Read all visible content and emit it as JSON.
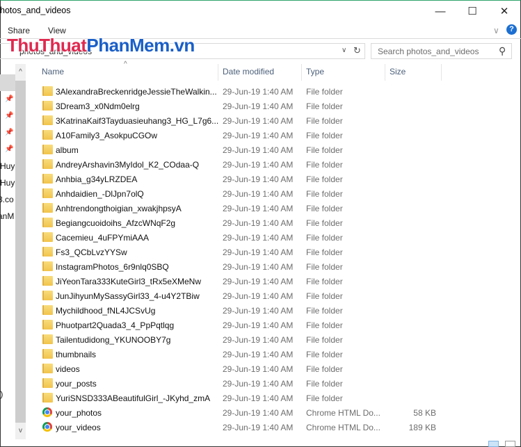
{
  "window": {
    "title": "hotos_and_videos",
    "minimize": "—",
    "maximize": "☐",
    "close": "✕"
  },
  "ribbon": {
    "share": "Share",
    "view": "View",
    "expand": "∨",
    "help": "?"
  },
  "watermark": {
    "part1": "ThuThuat",
    "part2": "PhanMem.vn"
  },
  "address": {
    "path": "photos_and_videos",
    "dropdown": "∨",
    "refresh": "↻"
  },
  "search": {
    "placeholder": "Search photos_and_videos",
    "icon": "⚲"
  },
  "nav": {
    "fragments": [
      "Huy",
      "Huy",
      "3.co",
      "anM",
      ":)"
    ]
  },
  "columns": {
    "name": "Name",
    "date": "Date modified",
    "type": "Type",
    "size": "Size"
  },
  "files": [
    {
      "name": "3AlexandraBreckenridgeJessieTheWalkin...",
      "date": "29-Jun-19 1:40 AM",
      "type": "File folder",
      "size": "",
      "icon": "folder"
    },
    {
      "name": "3Dream3_x0Ndm0elrg",
      "date": "29-Jun-19 1:40 AM",
      "type": "File folder",
      "size": "",
      "icon": "folder"
    },
    {
      "name": "3KatrinaKaif3Tayduasieuhang3_HG_L7g6...",
      "date": "29-Jun-19 1:40 AM",
      "type": "File folder",
      "size": "",
      "icon": "folder"
    },
    {
      "name": "A10Family3_AsokpuCGOw",
      "date": "29-Jun-19 1:40 AM",
      "type": "File folder",
      "size": "",
      "icon": "folder"
    },
    {
      "name": "album",
      "date": "29-Jun-19 1:40 AM",
      "type": "File folder",
      "size": "",
      "icon": "folder"
    },
    {
      "name": "AndreyArshavin3MyIdol_K2_COdaa-Q",
      "date": "29-Jun-19 1:40 AM",
      "type": "File folder",
      "size": "",
      "icon": "folder"
    },
    {
      "name": "Anhbia_g34yLRZDEA",
      "date": "29-Jun-19 1:40 AM",
      "type": "File folder",
      "size": "",
      "icon": "folder"
    },
    {
      "name": "Anhdaidien_-DlJpn7olQ",
      "date": "29-Jun-19 1:40 AM",
      "type": "File folder",
      "size": "",
      "icon": "folder"
    },
    {
      "name": "Anhtrendongthoigian_xwakjhpsyA",
      "date": "29-Jun-19 1:40 AM",
      "type": "File folder",
      "size": "",
      "icon": "folder"
    },
    {
      "name": "Begiangcuoidoihs_AfzcWNqF2g",
      "date": "29-Jun-19 1:40 AM",
      "type": "File folder",
      "size": "",
      "icon": "folder"
    },
    {
      "name": "Cacemieu_4uFPYmiAAA",
      "date": "29-Jun-19 1:40 AM",
      "type": "File folder",
      "size": "",
      "icon": "folder"
    },
    {
      "name": "Fs3_QCbLvzYYSw",
      "date": "29-Jun-19 1:40 AM",
      "type": "File folder",
      "size": "",
      "icon": "folder"
    },
    {
      "name": "InstagramPhotos_6r9nlq0SBQ",
      "date": "29-Jun-19 1:40 AM",
      "type": "File folder",
      "size": "",
      "icon": "folder"
    },
    {
      "name": "JiYeonTara333KuteGirl3_tRx5eXMeNw",
      "date": "29-Jun-19 1:40 AM",
      "type": "File folder",
      "size": "",
      "icon": "folder"
    },
    {
      "name": "JunJihyunMySassyGirl33_4-u4Y2TBiw",
      "date": "29-Jun-19 1:40 AM",
      "type": "File folder",
      "size": "",
      "icon": "folder"
    },
    {
      "name": "Mychildhood_fNL4JCSvUg",
      "date": "29-Jun-19 1:40 AM",
      "type": "File folder",
      "size": "",
      "icon": "folder"
    },
    {
      "name": "Phuotpart2Quada3_4_PpPqtlqg",
      "date": "29-Jun-19 1:40 AM",
      "type": "File folder",
      "size": "",
      "icon": "folder"
    },
    {
      "name": "Tailentudidong_YKUNOOBY7g",
      "date": "29-Jun-19 1:40 AM",
      "type": "File folder",
      "size": "",
      "icon": "folder"
    },
    {
      "name": "thumbnails",
      "date": "29-Jun-19 1:40 AM",
      "type": "File folder",
      "size": "",
      "icon": "folder"
    },
    {
      "name": "videos",
      "date": "29-Jun-19 1:40 AM",
      "type": "File folder",
      "size": "",
      "icon": "folder"
    },
    {
      "name": "your_posts",
      "date": "29-Jun-19 1:40 AM",
      "type": "File folder",
      "size": "",
      "icon": "folder"
    },
    {
      "name": "YuriSNSD333ABeautifulGirl_-JKyhd_zmA",
      "date": "29-Jun-19 1:40 AM",
      "type": "File folder",
      "size": "",
      "icon": "folder"
    },
    {
      "name": "your_photos",
      "date": "29-Jun-19 1:40 AM",
      "type": "Chrome HTML Do...",
      "size": "58 KB",
      "icon": "chrome"
    },
    {
      "name": "your_videos",
      "date": "29-Jun-19 1:40 AM",
      "type": "Chrome HTML Do...",
      "size": "189 KB",
      "icon": "chrome"
    }
  ]
}
